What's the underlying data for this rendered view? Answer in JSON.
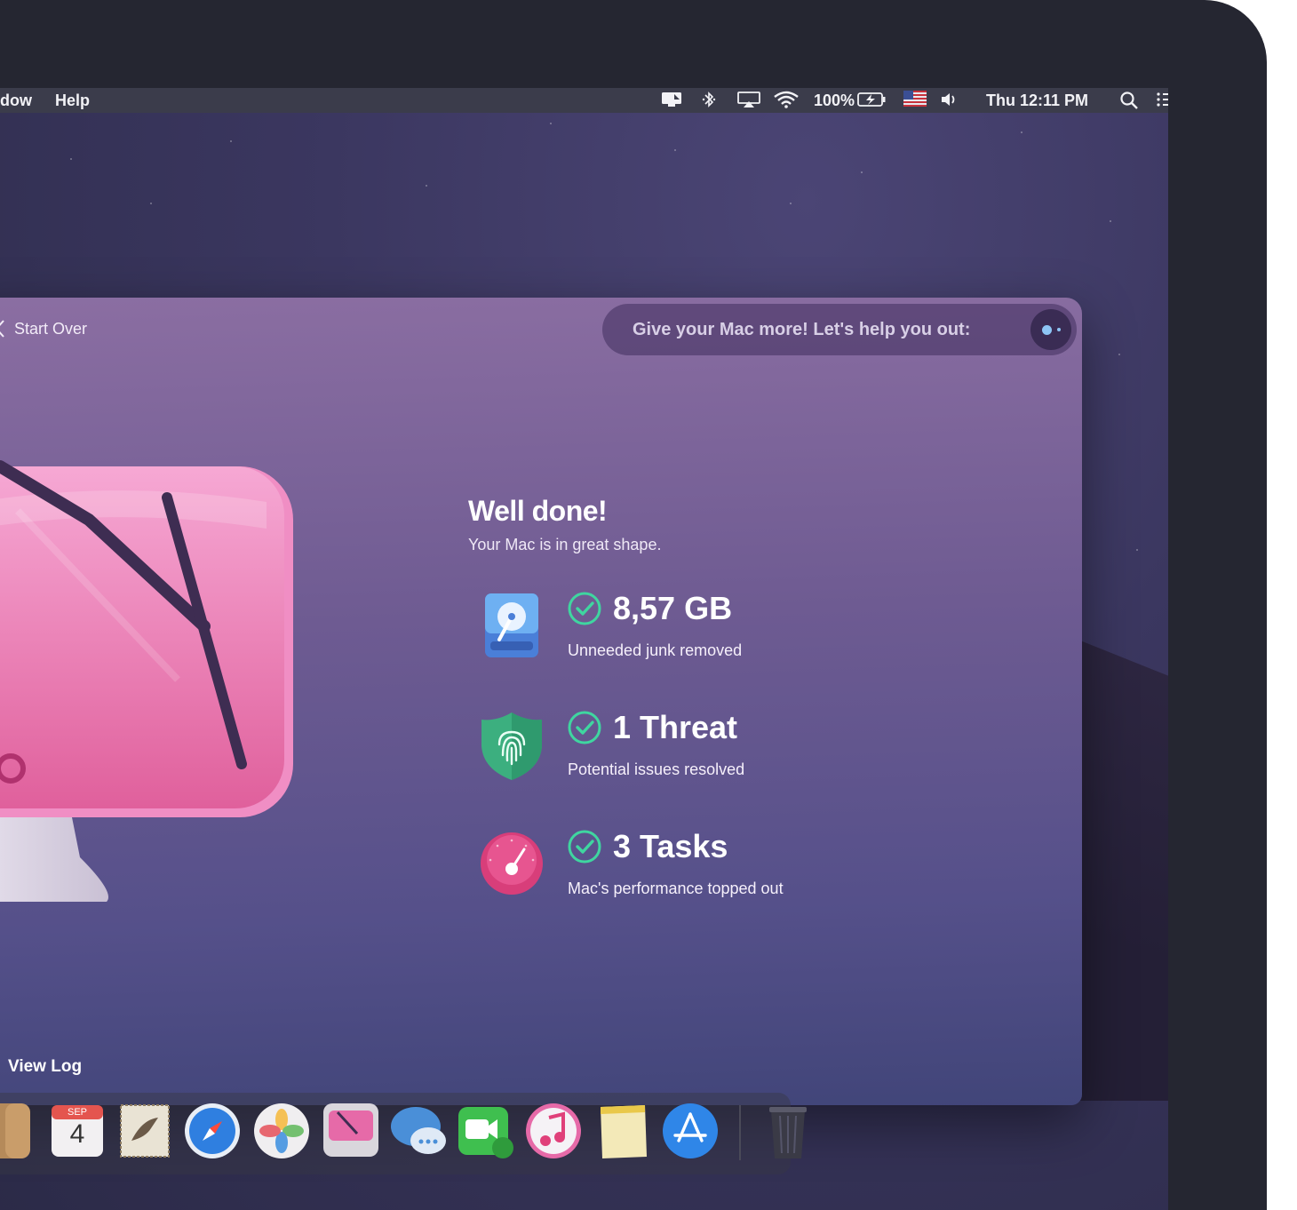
{
  "menubar": {
    "menus": [
      "dow",
      "Help"
    ],
    "battery": "100%",
    "clock": "Thu 12:11 PM",
    "status_icons": [
      "display-icon",
      "bluetooth-icon",
      "airplay-icon",
      "wifi-icon",
      "battery-icon",
      "flag-us-icon",
      "volume-icon",
      "spotlight-search-icon",
      "notification-center-icon"
    ]
  },
  "app": {
    "back_label": "Start Over",
    "promo_text": "Give your Mac more! Let's help you out:",
    "headline": "Well done!",
    "subline": "Your Mac is in great shape.",
    "stats": [
      {
        "icon": "hard-drive-icon",
        "value": "8,57 GB",
        "desc": "Unneeded junk removed"
      },
      {
        "icon": "shield-fingerprint-icon",
        "value": "1 Threat",
        "desc": "Potential issues resolved"
      },
      {
        "icon": "speedometer-icon",
        "value": "3 Tasks",
        "desc": "Mac's performance topped out"
      }
    ],
    "view_log_label": "View Log"
  },
  "dock": {
    "items": [
      "finder-icon",
      "calendar-icon",
      "mail-icon",
      "safari-icon",
      "photos-icon",
      "cleanmymac-icon",
      "messages-icon",
      "facetime-icon",
      "itunes-icon",
      "notes-icon",
      "app-store-icon",
      "trash-icon"
    ],
    "calendar": {
      "month": "SEP",
      "day": "4"
    }
  },
  "colors": {
    "accent_check": "#3fd6a0",
    "window_top": "#8b6ea2",
    "window_bottom": "#414579",
    "promo_dot": "#8ec5f5"
  }
}
